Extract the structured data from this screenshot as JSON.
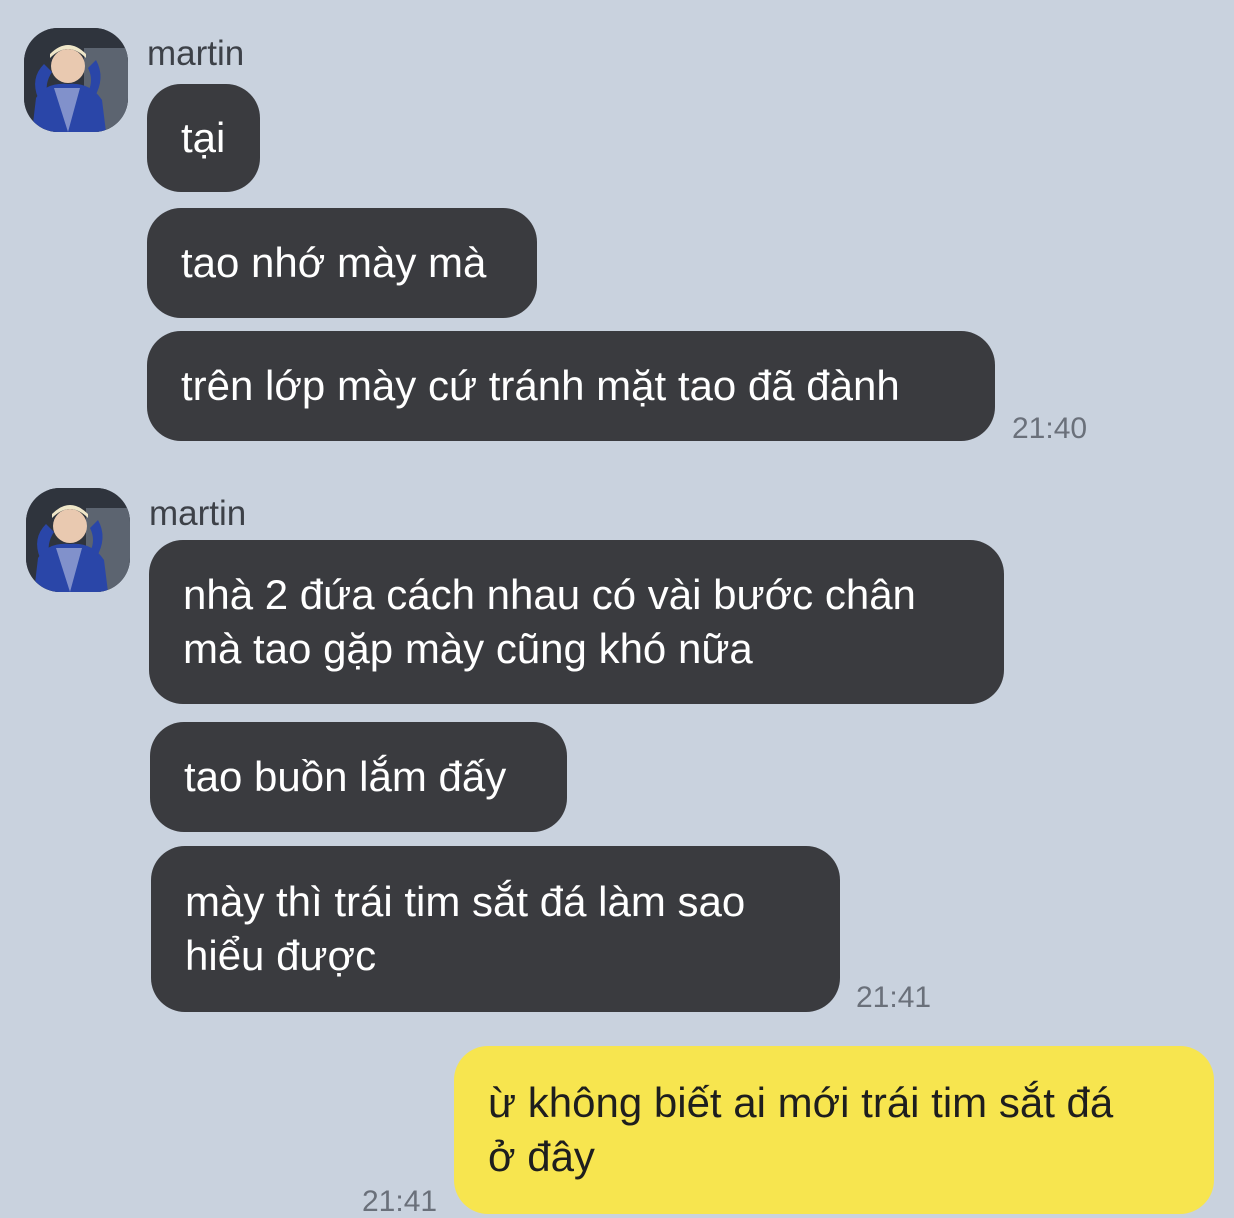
{
  "chat": {
    "groups": [
      {
        "sender": "martin",
        "time": "21:40",
        "messages": [
          "tại",
          "tao nhớ mày mà",
          "trên lớp mày cứ tránh mặt tao đã đành"
        ]
      },
      {
        "sender": "martin",
        "time": "21:41",
        "messages": [
          "nhà 2 đứa cách nhau có vài bước chân\nmà tao gặp mày cũng khó nữa",
          "tao buồn lắm đấy",
          "mày thì trái tim sắt đá làm sao\nhiểu được"
        ]
      }
    ],
    "outgoing": {
      "text": "ừ không biết ai mới trái tim sắt đá\nở đây",
      "time": "21:41"
    }
  },
  "colors": {
    "background": "#c9d2de",
    "incoming_bubble": "#3a3b3f",
    "outgoing_bubble": "#f7e54f"
  },
  "icons": {
    "avatar": "profile-photo-avatar"
  }
}
